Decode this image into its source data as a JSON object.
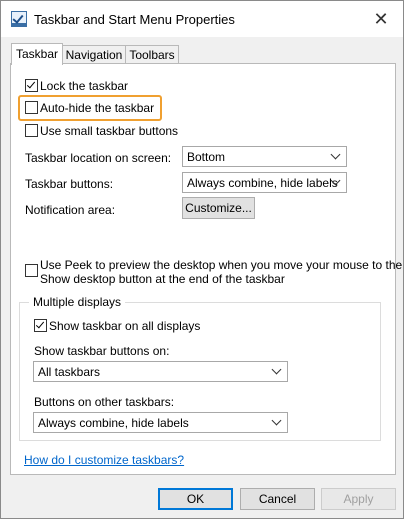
{
  "window": {
    "title": "Taskbar and Start Menu Properties",
    "close_glyph": "✕"
  },
  "tabs": [
    {
      "label": "Taskbar"
    },
    {
      "label": "Navigation"
    },
    {
      "label": "Toolbars"
    }
  ],
  "options": {
    "lock": {
      "label": "Lock the taskbar",
      "checked": true
    },
    "autohide": {
      "label": "Auto-hide the taskbar",
      "checked": false
    },
    "small": {
      "label": "Use small taskbar buttons",
      "checked": false
    }
  },
  "location": {
    "label": "Taskbar location on screen:",
    "value": "Bottom"
  },
  "buttons_combine": {
    "label": "Taskbar buttons:",
    "value": "Always combine, hide labels"
  },
  "notification": {
    "label": "Notification area:",
    "button": "Customize..."
  },
  "peek": {
    "line1": "Use Peek to preview the desktop when you move your mouse to the",
    "line2": "Show desktop button at the end of the taskbar",
    "checked": false
  },
  "multiple_displays": {
    "title": "Multiple displays",
    "show_all": {
      "label": "Show taskbar on all displays",
      "checked": true
    },
    "show_on": {
      "label": "Show taskbar buttons on:",
      "value": "All taskbars"
    },
    "other": {
      "label": "Buttons on other taskbars:",
      "value": "Always combine, hide labels"
    }
  },
  "help_link": "How do I customize taskbars?",
  "footer": {
    "ok": "OK",
    "cancel": "Cancel",
    "apply": "Apply"
  }
}
